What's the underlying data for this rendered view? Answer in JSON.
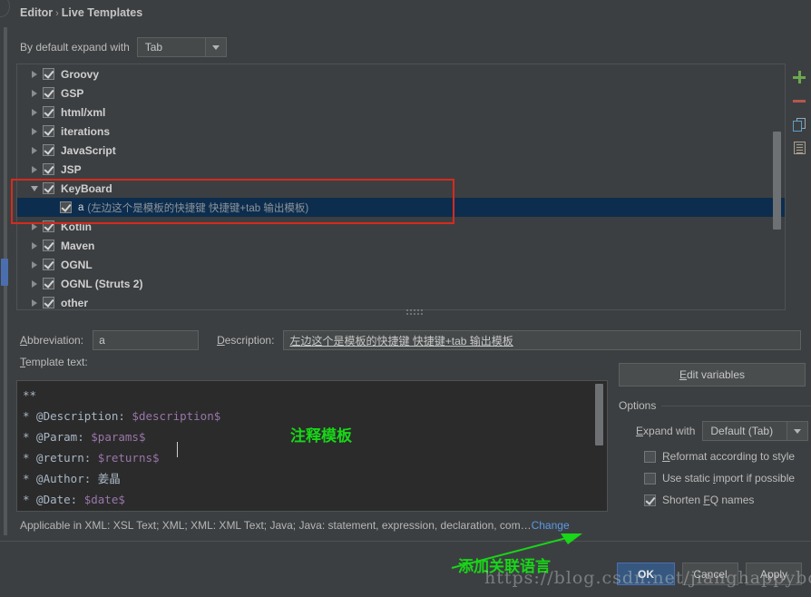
{
  "breadcrumb": {
    "parent": "Editor",
    "separator": "›",
    "current": "Live Templates"
  },
  "expand_default": {
    "label": "By default expand with",
    "value": "Tab"
  },
  "tree": {
    "scrollbar_name": "tree-vertical-scrollbar",
    "items": [
      {
        "label": "Groovy",
        "expanded": false,
        "checked": true,
        "type": "group"
      },
      {
        "label": "GSP",
        "expanded": false,
        "checked": true,
        "type": "group"
      },
      {
        "label": "html/xml",
        "expanded": false,
        "checked": true,
        "type": "group"
      },
      {
        "label": "iterations",
        "expanded": false,
        "checked": true,
        "type": "group"
      },
      {
        "label": "JavaScript",
        "expanded": false,
        "checked": true,
        "type": "group"
      },
      {
        "label": "JSP",
        "expanded": false,
        "checked": true,
        "type": "group"
      },
      {
        "label": "KeyBoard",
        "expanded": true,
        "checked": true,
        "type": "group"
      },
      {
        "abbr": "a",
        "desc": "(左边这个是模板的快捷键 快捷键+tab 输出模板)",
        "checked": true,
        "selected": true,
        "type": "template"
      },
      {
        "label": "Kotlin",
        "expanded": false,
        "checked": true,
        "type": "group"
      },
      {
        "label": "Maven",
        "expanded": false,
        "checked": true,
        "type": "group"
      },
      {
        "label": "OGNL",
        "expanded": false,
        "checked": true,
        "type": "group"
      },
      {
        "label": "OGNL (Struts 2)",
        "expanded": false,
        "checked": true,
        "type": "group"
      },
      {
        "label": "other",
        "expanded": false,
        "checked": true,
        "type": "group"
      }
    ]
  },
  "toolbar": {
    "add": "add-template",
    "remove": "remove-template",
    "duplicate": "duplicate-template",
    "template_group": "template-group"
  },
  "fields": {
    "abbreviation_label": "Abbreviation:",
    "abbreviation_value": "a",
    "description_label": "Description:",
    "description_value": "左边这个是模板的快捷键 快捷键+tab 输出模板",
    "template_text_label": "Template text:"
  },
  "template_text": {
    "lines": [
      "**",
      "* @Description: $description$",
      "* @Param: $params$",
      "* @return: $returns$ ",
      "* @Author: 姜晶",
      "* @Date: $date$"
    ]
  },
  "edit_variables": {
    "label": "Edit variables"
  },
  "options": {
    "title": "Options",
    "expand_with_label": "Expand with",
    "expand_with_value": "Default (Tab)",
    "checkboxes": [
      {
        "label": "Reformat according to style",
        "checked": false
      },
      {
        "label": "Use static import if possible",
        "checked": false
      },
      {
        "label": "Shorten FQ names",
        "checked": true
      }
    ]
  },
  "applicable": {
    "text": "Applicable in XML: XSL Text; XML; XML: XML Text; Java; Java: statement, expression, declaration, com…",
    "change_label": "Change"
  },
  "buttons": {
    "ok": "OK",
    "cancel": "Cancel",
    "apply": "Apply"
  },
  "annotations": {
    "template_note": "注释模板",
    "language_note": "添加关联语言",
    "watermark": "https://blog.csdn.net/jianghappyboy"
  },
  "colors": {
    "background": "#3c3f41",
    "selection": "#0d2d4e",
    "accent_blue": "#4b6eaf",
    "link": "#5a9ae6",
    "annotation_red": "#d52b1e",
    "annotation_green": "#18d618",
    "editor_bg": "#2b2b2b",
    "variable_purple": "#9876aa",
    "add_green": "#6aa84f",
    "remove_red": "#b4584c"
  }
}
